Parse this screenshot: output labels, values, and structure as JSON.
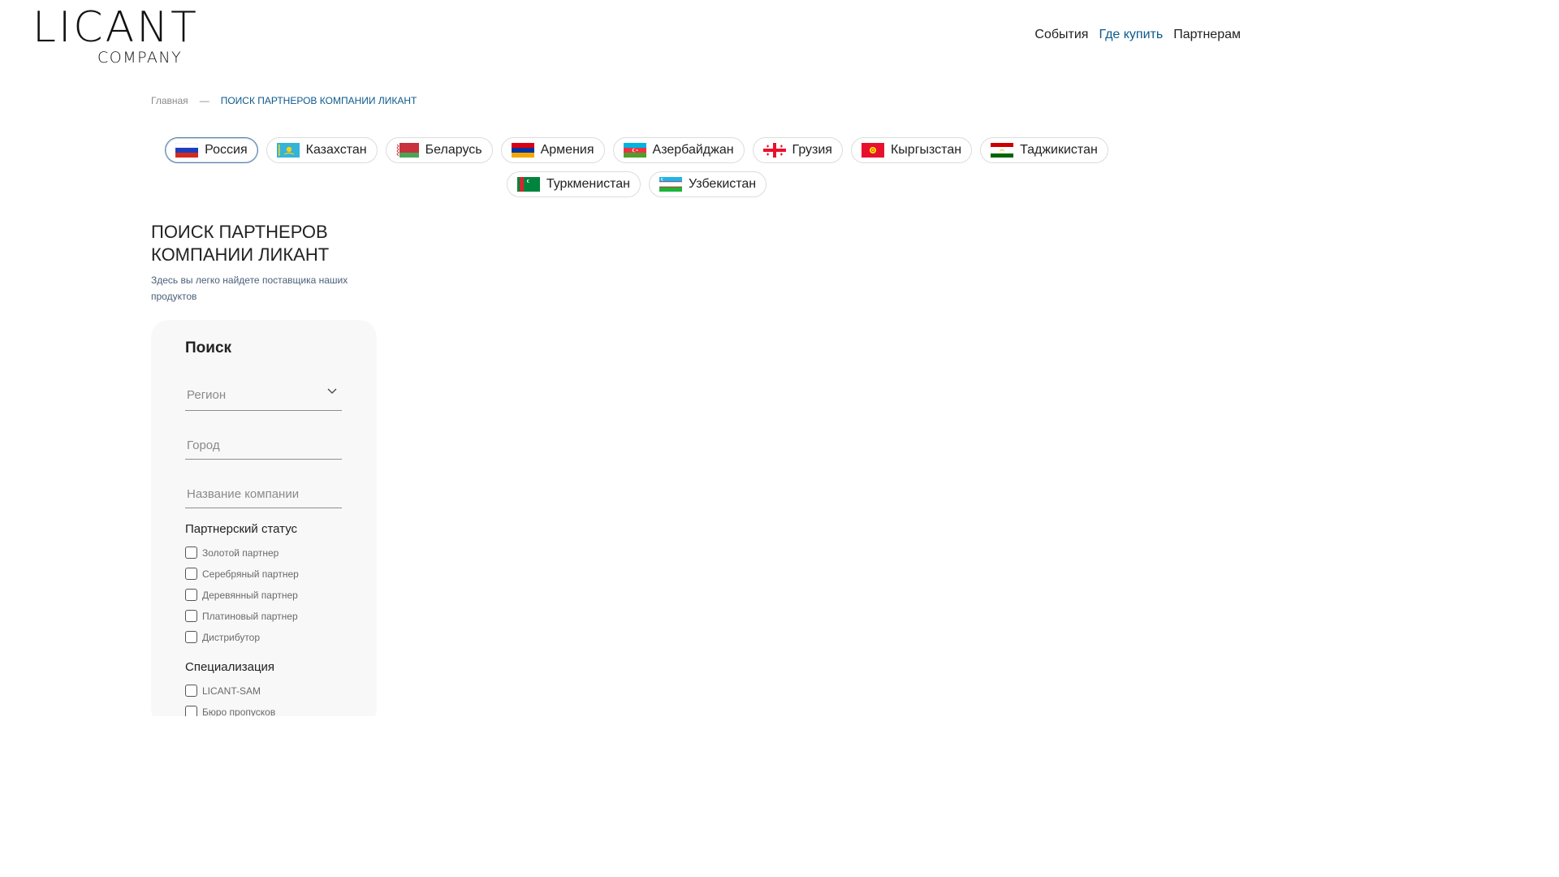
{
  "brand": {
    "name": "LICANT",
    "sub": "COMPANY"
  },
  "nav": {
    "events": "События",
    "where_to_buy": "Где купить",
    "partners": "Партнерам"
  },
  "breadcrumb": {
    "home": "Главная",
    "separator": "—",
    "current": "ПОИСК ПАРТНЕРОВ КОМПАНИИ ЛИКАНТ"
  },
  "countries": [
    {
      "label": "Россия",
      "flag": "russia-flag-icon",
      "selected": true
    },
    {
      "label": "Казахстан",
      "flag": "kazakhstan-flag-icon"
    },
    {
      "label": "Беларусь",
      "flag": "belarus-flag-icon"
    },
    {
      "label": "Армения",
      "flag": "armenia-flag-icon"
    },
    {
      "label": "Азербайджан",
      "flag": "azerbaijan-flag-icon"
    },
    {
      "label": "Грузия",
      "flag": "georgia-flag-icon"
    },
    {
      "label": "Кыргызстан",
      "flag": "kyrgyzstan-flag-icon"
    },
    {
      "label": "Таджикистан",
      "flag": "tajikistan-flag-icon"
    },
    {
      "label": "Туркменистан",
      "flag": "turkmenistan-flag-icon"
    },
    {
      "label": "Узбекистан",
      "flag": "uzbekistan-flag-icon"
    }
  ],
  "title": {
    "line1": "ПОИСК ПАРТНЕРОВ",
    "line2": "КОМПАНИИ ЛИКАНТ",
    "subtitle": "Здесь вы легко найдете поставщика наших продуктов"
  },
  "search": {
    "title": "Поиск",
    "region_placeholder": "Регион",
    "city_placeholder": "Город",
    "company_placeholder": "Название компании",
    "status_title": "Партнерский статус",
    "statuses": [
      "Золотой партнер",
      "Серебряный партнер",
      "Деревянный партнер",
      "Платиновый партнер",
      "Дистрибутор"
    ],
    "specialization_title": "Специализация",
    "specializations": [
      "LICANT-SAM",
      "Бюро пропусков"
    ]
  },
  "colors": {
    "accent": "#0b5a8c",
    "panel_bg": "#f8f8f8",
    "muted_text": "#8a8a8a"
  }
}
